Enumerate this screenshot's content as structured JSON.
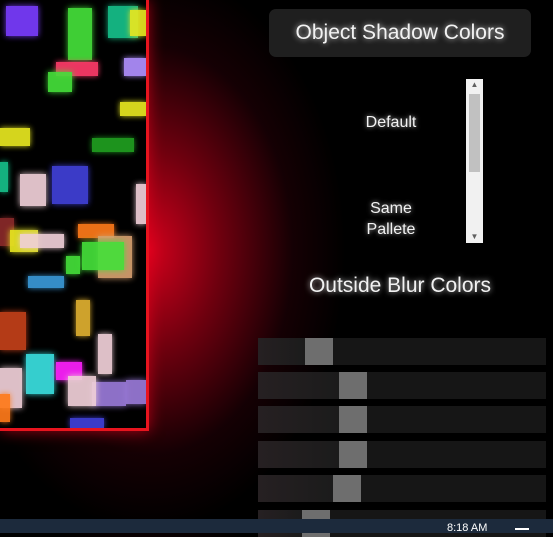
{
  "header": {
    "title": "Object Shadow Colors"
  },
  "shadow_options": {
    "items": [
      {
        "label": "Default"
      },
      {
        "label": "Same\nPallete"
      }
    ]
  },
  "blur": {
    "title": "Outside Blur Colors"
  },
  "sliders": [
    {
      "name": "blur-slider-1",
      "value": 0.18
    },
    {
      "name": "blur-slider-2",
      "value": 0.31
    },
    {
      "name": "blur-slider-3",
      "value": 0.31
    },
    {
      "name": "blur-slider-4",
      "value": 0.31
    },
    {
      "name": "blur-slider-5",
      "value": 0.29
    },
    {
      "name": "blur-slider-6",
      "value": 0.17
    }
  ],
  "taskbar": {
    "time": "8:18 AM"
  },
  "canvas": {
    "accent_color": "#e8141e",
    "rect_colors": [
      "#7a3cff",
      "#45e03a",
      "#16c08a",
      "#e8e820",
      "#ff3b6a",
      "#4040d8",
      "#f0d0d8",
      "#ff7a1a",
      "#3ae0e0",
      "#ff20ff",
      "#b090ff",
      "#c4401a",
      "#20a020",
      "#9a7ad8",
      "#e0b030",
      "#8a2a2a",
      "#3a9ad8",
      "#d8a070"
    ]
  }
}
